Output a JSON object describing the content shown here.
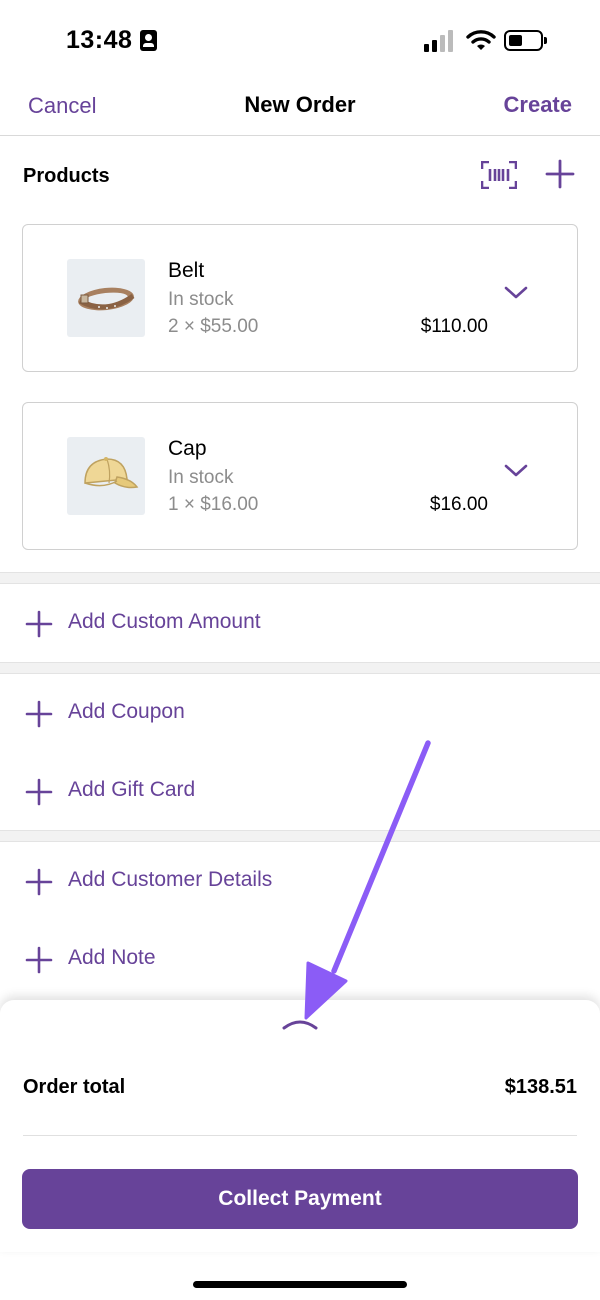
{
  "status_bar": {
    "time": "13:48",
    "icons": [
      "contact-card-icon",
      "signal-icon",
      "wifi-icon",
      "battery-icon"
    ]
  },
  "nav": {
    "cancel_label": "Cancel",
    "title": "New Order",
    "create_label": "Create"
  },
  "products": {
    "title": "Products",
    "scan_icon": "barcode-scan-icon",
    "add_icon": "plus-icon",
    "items": [
      {
        "name": "Belt",
        "stock": "In stock",
        "qty_price": "2 × $55.00",
        "total": "$110.00",
        "thumb": "belt-image",
        "expand_icon": "chevron-down-icon"
      },
      {
        "name": "Cap",
        "stock": "In stock",
        "qty_price": "1 × $16.00",
        "total": "$16.00",
        "thumb": "cap-image",
        "expand_icon": "chevron-down-icon"
      }
    ]
  },
  "actions": {
    "custom_amount": "Add Custom Amount",
    "coupon": "Add Coupon",
    "gift_card": "Add Gift Card",
    "customer_details": "Add Customer Details",
    "note": "Add Note"
  },
  "summary": {
    "handle_icon": "chevron-up-icon",
    "order_total_label": "Order total",
    "order_total_value": "$138.51",
    "collect_label": "Collect Payment"
  },
  "colors": {
    "accent": "#674399",
    "annotation_arrow": "#8B5CF6",
    "muted_text": "#8c8c8c",
    "thumb_bg": "#eaeef2"
  }
}
